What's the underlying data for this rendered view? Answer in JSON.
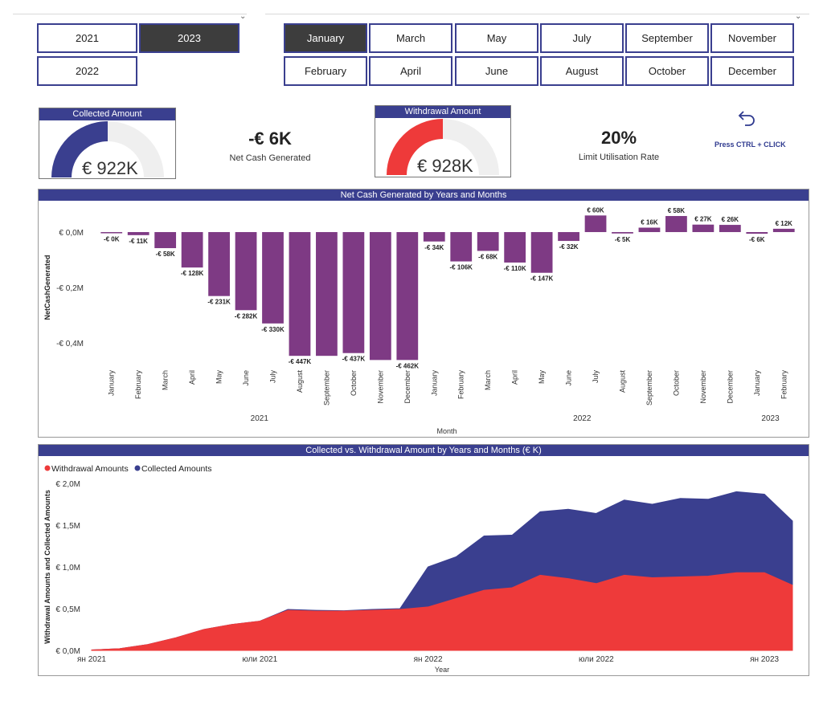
{
  "years": [
    {
      "label": "2021",
      "selected": false
    },
    {
      "label": "2023",
      "selected": true
    },
    {
      "label": "2022",
      "selected": false
    }
  ],
  "months": [
    {
      "label": "January",
      "selected": true
    },
    {
      "label": "March",
      "selected": false
    },
    {
      "label": "May",
      "selected": false
    },
    {
      "label": "July",
      "selected": false
    },
    {
      "label": "September",
      "selected": false
    },
    {
      "label": "November",
      "selected": false
    },
    {
      "label": "February",
      "selected": false
    },
    {
      "label": "April",
      "selected": false
    },
    {
      "label": "June",
      "selected": false
    },
    {
      "label": "August",
      "selected": false
    },
    {
      "label": "October",
      "selected": false
    },
    {
      "label": "December",
      "selected": false
    }
  ],
  "collected": {
    "title": "Collected Amount",
    "value": "€ 922K",
    "fill": 0.5,
    "color": "#3a3f8f"
  },
  "withdrawal": {
    "title": "Withdrawal Amount",
    "value": "€ 928K",
    "fill": 0.5,
    "color": "#ee3a3a"
  },
  "net_cash": {
    "value": "-€ 6K",
    "label": "Net Cash Generated"
  },
  "limit": {
    "value": "20%",
    "label": "Limit Utilisation Rate"
  },
  "back": {
    "label": "Press CTRL + CLICK",
    "icon": "back-arrow-icon"
  },
  "colors": {
    "accent": "#3a3f8f",
    "bar": "#7e3a84",
    "red": "#ee3a3a",
    "blue": "#3a3f8f"
  },
  "chart_data": [
    {
      "type": "bar",
      "title": "Net Cash Generated by Years and Months",
      "xlabel": "Month",
      "ylabel": "NetCashGenerated",
      "yticks": [
        "€ 0,0M",
        "-€ 0,2M",
        "-€ 0,4M"
      ],
      "ytick_values": [
        0,
        -200,
        -400
      ],
      "ylim": [
        -490,
        90
      ],
      "units": "€ K",
      "categories": [
        "January",
        "February",
        "March",
        "April",
        "May",
        "June",
        "July",
        "August",
        "September",
        "October",
        "November",
        "December",
        "January",
        "February",
        "March",
        "April",
        "May",
        "June",
        "July",
        "August",
        "September",
        "October",
        "November",
        "December",
        "January",
        "February"
      ],
      "values": [
        -3,
        -11,
        -58,
        -128,
        -231,
        -282,
        -330,
        -447,
        -447,
        -437,
        -462,
        -462,
        -34,
        -106,
        -68,
        -110,
        -147,
        -32,
        60,
        -5,
        16,
        58,
        27,
        26,
        -6,
        12
      ],
      "data_labels": [
        "-€ 0K",
        "-€ 11K",
        "-€ 58K",
        "-€ 128K",
        "-€ 231K",
        "-€ 282K",
        "-€ 330K",
        "-€ 447K",
        "",
        "-€ 437K",
        "",
        "-€ 462K",
        "-€ 34K",
        "-€ 106K",
        "-€ 68K",
        "-€ 110K",
        "-€ 147K",
        "-€ 32K",
        "€ 60K",
        "-€ 5K",
        "€ 16K",
        "€ 58K",
        "€ 27K",
        "€ 26K",
        "-€ 6K",
        "€ 12K"
      ],
      "groups": [
        {
          "label": "2021",
          "start": 0,
          "end": 11
        },
        {
          "label": "2022",
          "start": 12,
          "end": 23
        },
        {
          "label": "2023",
          "start": 24,
          "end": 25
        }
      ]
    },
    {
      "type": "area",
      "title": "Collected vs. Withdrawal Amount by Years and Months (€ K)",
      "xlabel": "Year",
      "ylabel": "Withdrawal Amounts and Collected Amounts",
      "yticks": [
        "€ 0,0M",
        "€ 0,5M",
        "€ 1,0M",
        "€ 1,5M",
        "€ 2,0M"
      ],
      "ytick_values": [
        0,
        500,
        1000,
        1500,
        2000
      ],
      "ylim": [
        0,
        2000
      ],
      "xticks": [
        {
          "label": "ян 2021",
          "index": 0
        },
        {
          "label": "юли 2021",
          "index": 6
        },
        {
          "label": "ян 2022",
          "index": 12
        },
        {
          "label": "юли 2022",
          "index": 18
        },
        {
          "label": "ян 2023",
          "index": 24
        }
      ],
      "x": [
        "2021-01",
        "2021-02",
        "2021-03",
        "2021-04",
        "2021-05",
        "2021-06",
        "2021-07",
        "2021-08",
        "2021-09",
        "2021-10",
        "2021-11",
        "2021-12",
        "2022-01",
        "2022-02",
        "2022-03",
        "2022-04",
        "2022-05",
        "2022-06",
        "2022-07",
        "2022-08",
        "2022-09",
        "2022-10",
        "2022-11",
        "2022-12",
        "2023-01",
        "2023-02"
      ],
      "series": [
        {
          "name": "Withdrawal Amounts",
          "color": "#ee3a3a",
          "values": [
            5,
            20,
            70,
            150,
            250,
            310,
            350,
            480,
            470,
            470,
            480,
            490,
            520,
            620,
            720,
            750,
            900,
            860,
            800,
            900,
            870,
            880,
            890,
            930,
            930,
            780
          ]
        },
        {
          "name": "Collected Amounts",
          "color": "#3a3f8f",
          "values": [
            5,
            20,
            70,
            150,
            250,
            310,
            350,
            490,
            480,
            475,
            490,
            500,
            1000,
            1120,
            1370,
            1380,
            1660,
            1690,
            1640,
            1800,
            1750,
            1820,
            1810,
            1900,
            1870,
            1550
          ]
        }
      ]
    }
  ]
}
